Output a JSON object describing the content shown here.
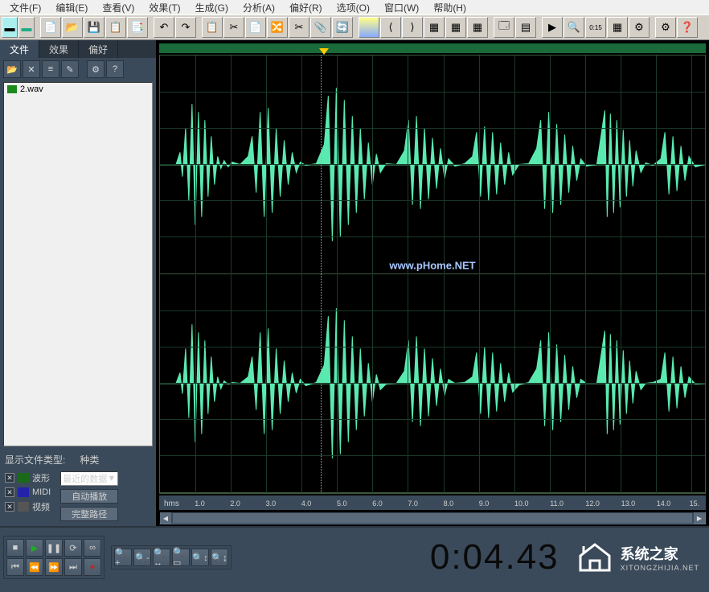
{
  "menu": {
    "items": [
      "文件(F)",
      "编辑(E)",
      "查看(V)",
      "效果(T)",
      "生成(G)",
      "分析(A)",
      "偏好(R)",
      "选项(O)",
      "窗口(W)",
      "帮助(H)"
    ]
  },
  "sidebar": {
    "tabs": [
      "文件",
      "效果",
      "偏好"
    ],
    "active_tab": 0,
    "file": {
      "name": "2.wav"
    },
    "bottom": {
      "filetype_label": "显示文件类型:",
      "category_label": "种类",
      "waveform_label": "波形",
      "midi_label": "MIDI",
      "video_label": "视频",
      "dropdown_value": "最近的数据",
      "autoplay_btn": "自动播放",
      "fullpath_btn": "完整路径"
    }
  },
  "ruler": {
    "unit": "hms",
    "ticks": [
      "1.0",
      "2.0",
      "3.0",
      "4.0",
      "5.0",
      "6.0",
      "7.0",
      "8.0",
      "9.0",
      "10.0",
      "11.0",
      "12.0",
      "13.0",
      "14.0",
      "15."
    ]
  },
  "playhead_position_sec": 4.43,
  "time_display": "0:04.43",
  "watermark": "www.pHome.NET",
  "logo": {
    "main": "系统之家",
    "sub": "XITONGZHIJIA.NET"
  },
  "colors": {
    "waveform": "#5aeab0",
    "bg": "#000000",
    "grid": "#1a3a2a",
    "panel": "#3a4a5a"
  }
}
